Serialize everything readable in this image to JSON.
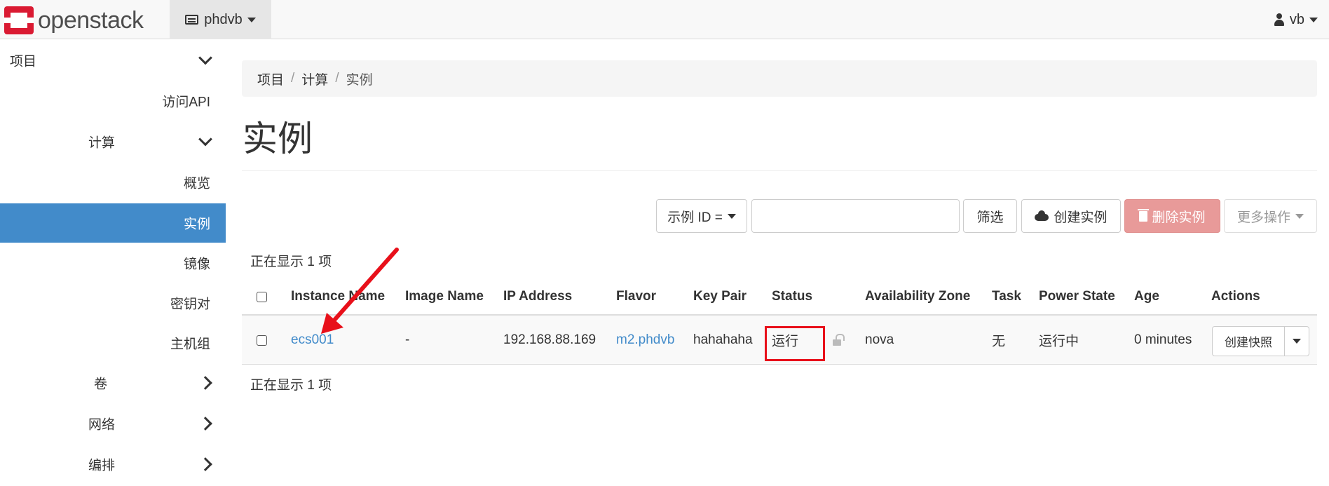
{
  "navbar": {
    "brand": "openstack",
    "project": "phdvb",
    "user": "vb"
  },
  "sidebar": {
    "items": [
      {
        "label": "项目",
        "kind": "section",
        "chevron": "down"
      },
      {
        "label": "访问API",
        "kind": "link"
      },
      {
        "label": "计算",
        "kind": "group",
        "chevron": "down"
      },
      {
        "label": "概览",
        "kind": "link"
      },
      {
        "label": "实例",
        "kind": "link",
        "active": true
      },
      {
        "label": "镜像",
        "kind": "link"
      },
      {
        "label": "密钥对",
        "kind": "link"
      },
      {
        "label": "主机组",
        "kind": "link"
      },
      {
        "label": "卷",
        "kind": "group",
        "chevron": "right"
      },
      {
        "label": "网络",
        "kind": "group",
        "chevron": "right"
      },
      {
        "label": "编排",
        "kind": "group",
        "chevron": "right"
      }
    ]
  },
  "breadcrumb": [
    "项目",
    "计算",
    "实例"
  ],
  "page": {
    "title": "实例"
  },
  "toolbar": {
    "filter_field": "示例 ID =",
    "search_value": "",
    "filter_label": "筛选",
    "launch_label": "创建实例",
    "delete_label": "删除实例",
    "more_label": "更多操作"
  },
  "table": {
    "count_text": "正在显示 1 项",
    "columns": [
      "Instance Name",
      "Image Name",
      "IP Address",
      "Flavor",
      "Key Pair",
      "Status",
      "Availability Zone",
      "Task",
      "Power State",
      "Age",
      "Actions"
    ],
    "rows": [
      {
        "instance_name": "ecs001",
        "image_name": "-",
        "ip_address": "192.168.88.169",
        "flavor": "m2.phdvb",
        "key_pair": "hahahaha",
        "status": "运行",
        "availability_zone": "nova",
        "task": "无",
        "power_state": "运行中",
        "age": "0 minutes",
        "action_label": "创建快照"
      }
    ]
  },
  "colors": {
    "accent": "#428bca",
    "danger": "#e89a99",
    "annotation": "#e8101a",
    "brand_red": "#da1a32"
  }
}
